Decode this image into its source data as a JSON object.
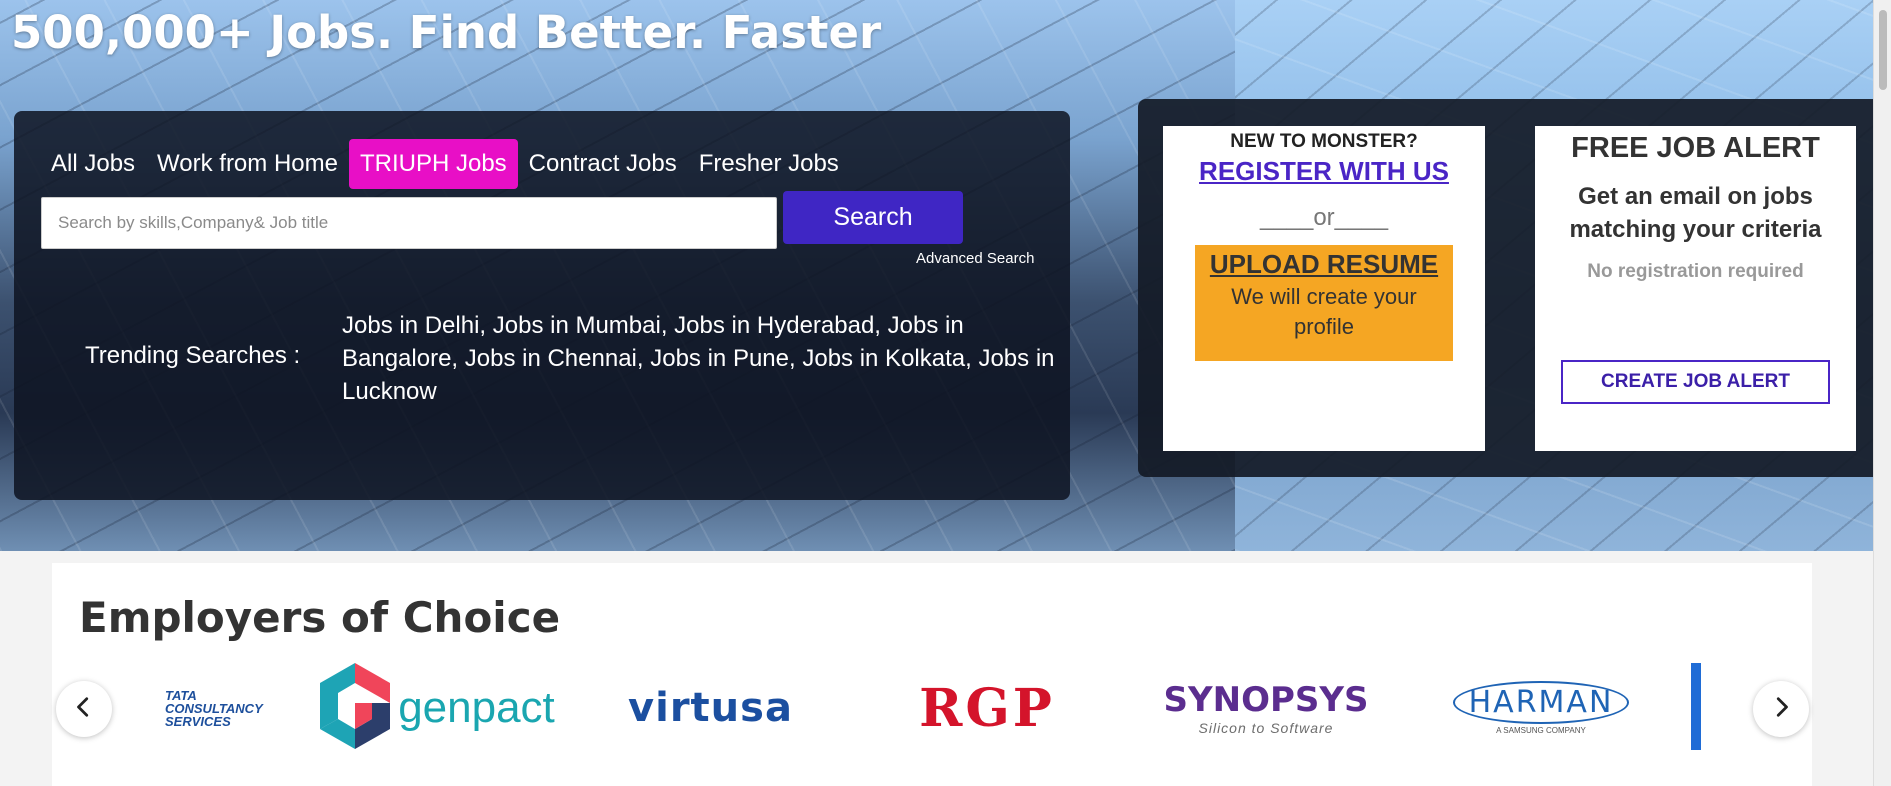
{
  "hero": {
    "headline": "500,000+ Jobs. Find Better. Faster"
  },
  "search": {
    "tabs": [
      {
        "label": "All Jobs",
        "active": false
      },
      {
        "label": "Work from Home",
        "active": false
      },
      {
        "label": "TRIUPH Jobs",
        "active": true
      },
      {
        "label": "Contract Jobs",
        "active": false
      },
      {
        "label": "Fresher Jobs",
        "active": false
      }
    ],
    "placeholder": "Search by skills,Company& Job title",
    "value": "",
    "button_label": "Search",
    "advanced_label": "Advanced Search",
    "trending_label": "Trending Searches :",
    "trending": [
      "Jobs in Delhi",
      "Jobs in Mumbai",
      "Jobs in Hyderabad",
      "Jobs in Bangalore",
      "Jobs in Chennai",
      "Jobs in Pune",
      "Jobs in Kolkata",
      "Jobs in Lucknow"
    ]
  },
  "register": {
    "new_label": "NEW TO MONSTER?",
    "register_link": "REGISTER WITH US",
    "or_text": "____or____",
    "upload_title": "UPLOAD RESUME",
    "upload_sub": "We will create your profile"
  },
  "alert": {
    "title": "FREE JOB ALERT",
    "subtitle": "Get an email on jobs matching your criteria",
    "note": "No registration required",
    "button_label": "CREATE JOB ALERT"
  },
  "employers": {
    "title": "Employers of Choice",
    "logos": [
      {
        "name": "TATA CONSULTANCY SERVICES",
        "lines": [
          "TATA",
          "CONSULTANCY",
          "SERVICES"
        ]
      },
      {
        "name": "genpact"
      },
      {
        "name": "virtusa"
      },
      {
        "name": "RGP"
      },
      {
        "name": "SYNOPSYS",
        "sub": "Silicon to Software"
      },
      {
        "name": "HARMAN",
        "sub": "A SAMSUNG COMPANY"
      }
    ],
    "prev_icon": "chevron-left-icon",
    "next_icon": "chevron-right-icon"
  },
  "colors": {
    "accent_tab": "#e80fc6",
    "primary": "#3f26c4",
    "upload_bg": "#f5a623"
  }
}
